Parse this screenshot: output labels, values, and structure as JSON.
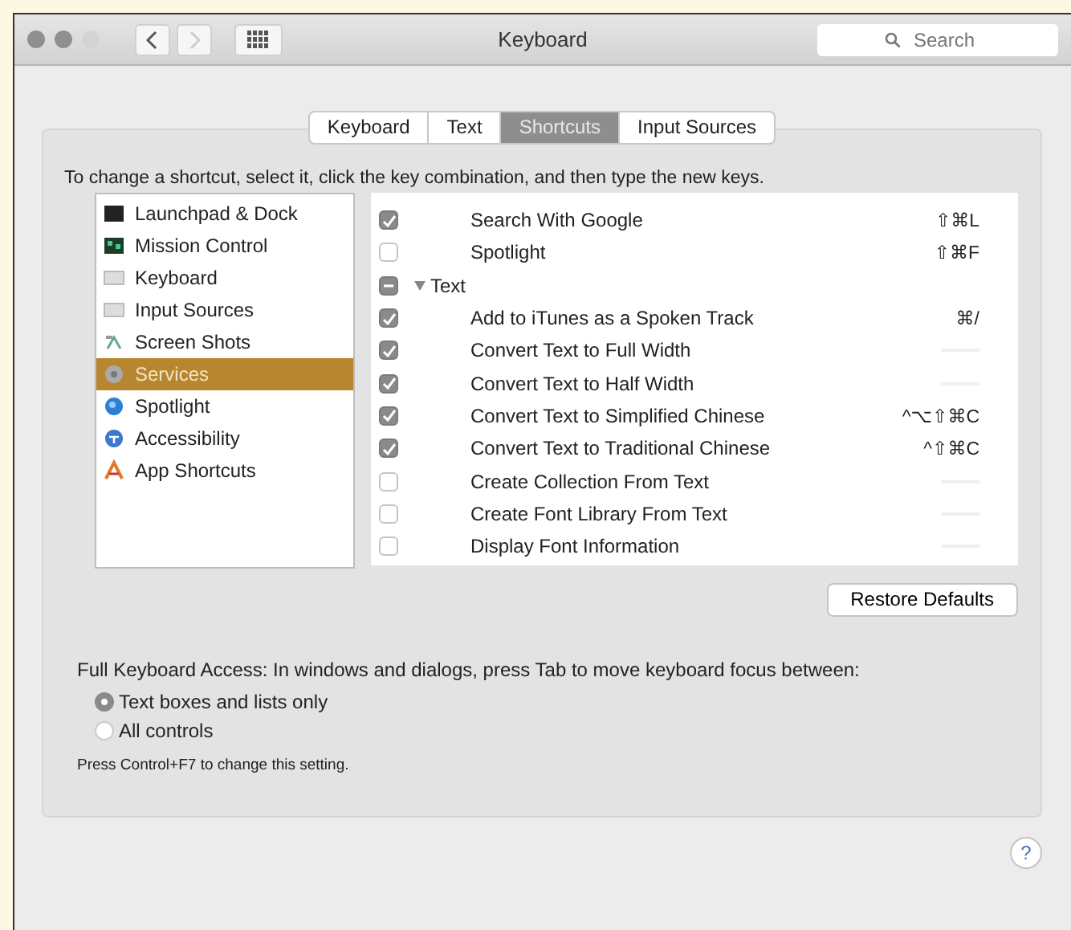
{
  "window": {
    "title": "Keyboard",
    "search": {
      "placeholder": "Search"
    }
  },
  "tabs": [
    {
      "label": "Keyboard",
      "selected": false
    },
    {
      "label": "Text",
      "selected": false
    },
    {
      "label": "Shortcuts",
      "selected": true
    },
    {
      "label": "Input Sources",
      "selected": false
    }
  ],
  "instructions": "To change a shortcut, select it, click the key combination, and then type the new keys.",
  "categories": [
    {
      "label": "Launchpad & Dock",
      "selected": false
    },
    {
      "label": "Mission Control",
      "selected": false
    },
    {
      "label": "Keyboard",
      "selected": false
    },
    {
      "label": "Input Sources",
      "selected": false
    },
    {
      "label": "Screen Shots",
      "selected": false
    },
    {
      "label": "Services",
      "selected": true
    },
    {
      "label": "Spotlight",
      "selected": false
    },
    {
      "label": "Accessibility",
      "selected": false
    },
    {
      "label": "App Shortcuts",
      "selected": false
    }
  ],
  "shortcuts": [
    {
      "kind": "item",
      "label": "Search With Google",
      "checked": true,
      "keys": "⇧⌘L"
    },
    {
      "kind": "item",
      "label": "Spotlight",
      "checked": false,
      "keys": "⇧⌘F"
    },
    {
      "kind": "group",
      "label": "Text",
      "mixed": true,
      "expanded": true,
      "children": [
        {
          "kind": "item",
          "label": "Add to iTunes as a Spoken Track",
          "checked": true,
          "keys": "⌘/"
        },
        {
          "kind": "item",
          "label": "Convert Text to Full Width",
          "checked": true
        },
        {
          "kind": "item",
          "label": "Convert Text to Half Width",
          "checked": true
        },
        {
          "kind": "item",
          "label": "Convert Text to Simplified Chinese",
          "checked": true,
          "keys": "^⌥⇧⌘C"
        },
        {
          "kind": "item",
          "label": "Convert Text to Traditional Chinese",
          "checked": true,
          "keys": "^⇧⌘C"
        },
        {
          "kind": "item",
          "label": "Create Collection From Text",
          "checked": false
        },
        {
          "kind": "item",
          "label": "Create Font Library From Text",
          "checked": false
        },
        {
          "kind": "item",
          "label": "Display Font Information",
          "checked": false
        }
      ]
    }
  ],
  "restore_button": "Restore Defaults",
  "full_keyboard_access": {
    "label": "Full Keyboard Access: In windows and dialogs, press Tab to move keyboard focus between:",
    "options": [
      {
        "label": "Text boxes and lists only",
        "selected": true
      },
      {
        "label": "All controls",
        "selected": false
      }
    ],
    "hint": "Press Control+F7 to change this setting."
  },
  "help_button": "?"
}
